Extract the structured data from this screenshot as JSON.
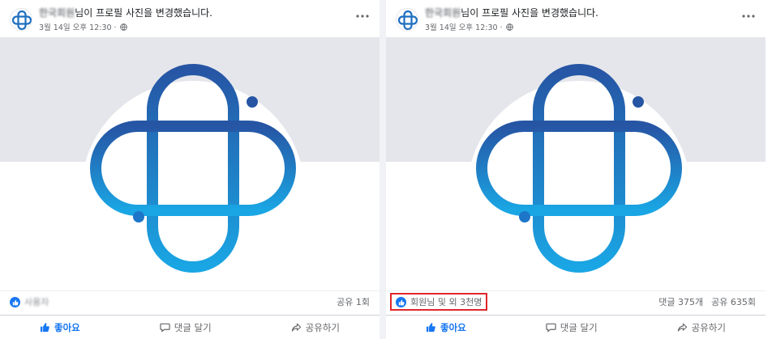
{
  "colors": {
    "facebook_blue": "#1877f2",
    "logo_dark": "#2655a4",
    "logo_light": "#1aa6e4",
    "highlight_red": "#e0262b",
    "cover_gray": "#e5e6eb"
  },
  "icons": {
    "more": "more-options-icon",
    "globe": "globe-icon",
    "like": "thumbs-up-icon",
    "comment": "comment-icon",
    "share": "share-icon"
  },
  "posts": [
    {
      "header": {
        "author": "한국회원",
        "action_text": "님이 프로필 사진을 변경했습니다.",
        "timestamp": "3월 14일 오후 12:30 ·"
      },
      "reactions": {
        "names": "사용자",
        "counts": [
          "공유 1회"
        ]
      },
      "actions": {
        "like": "좋아요",
        "comment": "댓글 달기",
        "share": "공유하기"
      }
    },
    {
      "header": {
        "author": "한국회원",
        "action_text": "님이 프로필 사진을 변경했습니다.",
        "timestamp": "3월 14일 오후 12:30 ·"
      },
      "reactions": {
        "names": "회원님 및 외 3천명",
        "counts": [
          "댓글 375개",
          "공유 635회"
        ]
      },
      "actions": {
        "like": "좋아요",
        "comment": "댓글 달기",
        "share": "공유하기"
      }
    }
  ]
}
